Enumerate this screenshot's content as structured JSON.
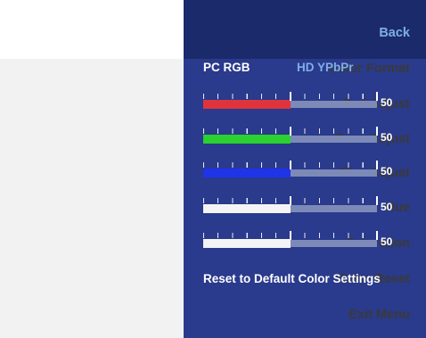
{
  "menu": {
    "items": [
      {
        "label": "Back"
      },
      {
        "label": "Color Format"
      },
      {
        "label": "Red Adjust"
      },
      {
        "label": "Geen Adjust"
      },
      {
        "label": "Blue Adjust"
      },
      {
        "label": "Hue"
      },
      {
        "label": "Saturation"
      },
      {
        "label": "Color Reset"
      },
      {
        "label": "Exit Menu"
      }
    ]
  },
  "color_format": {
    "options": [
      "PC RGB",
      "HD YPbPr"
    ],
    "selected": "PC RGB"
  },
  "sliders": [
    {
      "value": "50",
      "fill_color": "#e0343c"
    },
    {
      "value": "50",
      "fill_color": "#2bd12f"
    },
    {
      "value": "50",
      "fill_color": "#1f33e8"
    },
    {
      "value": "50",
      "fill_color": "#f4f4f4"
    },
    {
      "value": "50",
      "fill_color": "#f4f4f4"
    }
  ],
  "color_reset": {
    "label": "Reset to Default Color Settings"
  },
  "colors": {
    "menu_bg": "#f2f2f2",
    "panel_bg": "#2a3a8c",
    "panel_header_bg": "#1b2a6a",
    "accent": "#7eaee8"
  }
}
